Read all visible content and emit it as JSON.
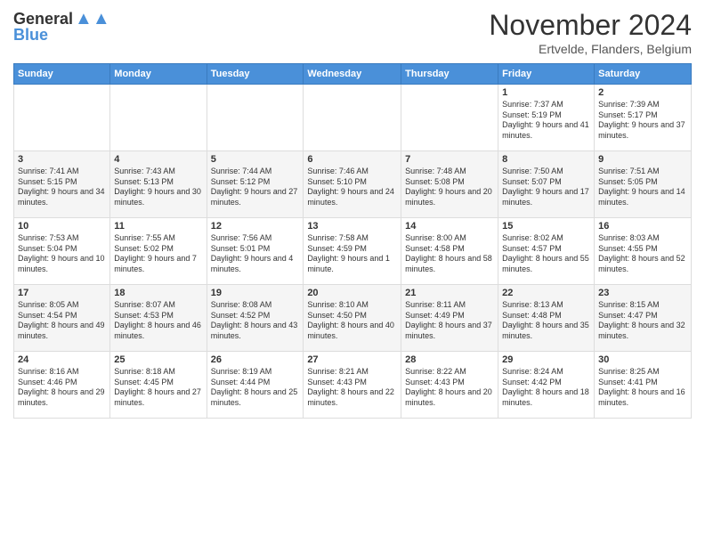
{
  "header": {
    "logo_line1": "General",
    "logo_line2": "Blue",
    "month_title": "November 2024",
    "location": "Ertvelde, Flanders, Belgium"
  },
  "days_of_week": [
    "Sunday",
    "Monday",
    "Tuesday",
    "Wednesday",
    "Thursday",
    "Friday",
    "Saturday"
  ],
  "weeks": [
    [
      {
        "day": "",
        "info": ""
      },
      {
        "day": "",
        "info": ""
      },
      {
        "day": "",
        "info": ""
      },
      {
        "day": "",
        "info": ""
      },
      {
        "day": "",
        "info": ""
      },
      {
        "day": "1",
        "info": "Sunrise: 7:37 AM\nSunset: 5:19 PM\nDaylight: 9 hours and 41 minutes."
      },
      {
        "day": "2",
        "info": "Sunrise: 7:39 AM\nSunset: 5:17 PM\nDaylight: 9 hours and 37 minutes."
      }
    ],
    [
      {
        "day": "3",
        "info": "Sunrise: 7:41 AM\nSunset: 5:15 PM\nDaylight: 9 hours and 34 minutes."
      },
      {
        "day": "4",
        "info": "Sunrise: 7:43 AM\nSunset: 5:13 PM\nDaylight: 9 hours and 30 minutes."
      },
      {
        "day": "5",
        "info": "Sunrise: 7:44 AM\nSunset: 5:12 PM\nDaylight: 9 hours and 27 minutes."
      },
      {
        "day": "6",
        "info": "Sunrise: 7:46 AM\nSunset: 5:10 PM\nDaylight: 9 hours and 24 minutes."
      },
      {
        "day": "7",
        "info": "Sunrise: 7:48 AM\nSunset: 5:08 PM\nDaylight: 9 hours and 20 minutes."
      },
      {
        "day": "8",
        "info": "Sunrise: 7:50 AM\nSunset: 5:07 PM\nDaylight: 9 hours and 17 minutes."
      },
      {
        "day": "9",
        "info": "Sunrise: 7:51 AM\nSunset: 5:05 PM\nDaylight: 9 hours and 14 minutes."
      }
    ],
    [
      {
        "day": "10",
        "info": "Sunrise: 7:53 AM\nSunset: 5:04 PM\nDaylight: 9 hours and 10 minutes."
      },
      {
        "day": "11",
        "info": "Sunrise: 7:55 AM\nSunset: 5:02 PM\nDaylight: 9 hours and 7 minutes."
      },
      {
        "day": "12",
        "info": "Sunrise: 7:56 AM\nSunset: 5:01 PM\nDaylight: 9 hours and 4 minutes."
      },
      {
        "day": "13",
        "info": "Sunrise: 7:58 AM\nSunset: 4:59 PM\nDaylight: 9 hours and 1 minute."
      },
      {
        "day": "14",
        "info": "Sunrise: 8:00 AM\nSunset: 4:58 PM\nDaylight: 8 hours and 58 minutes."
      },
      {
        "day": "15",
        "info": "Sunrise: 8:02 AM\nSunset: 4:57 PM\nDaylight: 8 hours and 55 minutes."
      },
      {
        "day": "16",
        "info": "Sunrise: 8:03 AM\nSunset: 4:55 PM\nDaylight: 8 hours and 52 minutes."
      }
    ],
    [
      {
        "day": "17",
        "info": "Sunrise: 8:05 AM\nSunset: 4:54 PM\nDaylight: 8 hours and 49 minutes."
      },
      {
        "day": "18",
        "info": "Sunrise: 8:07 AM\nSunset: 4:53 PM\nDaylight: 8 hours and 46 minutes."
      },
      {
        "day": "19",
        "info": "Sunrise: 8:08 AM\nSunset: 4:52 PM\nDaylight: 8 hours and 43 minutes."
      },
      {
        "day": "20",
        "info": "Sunrise: 8:10 AM\nSunset: 4:50 PM\nDaylight: 8 hours and 40 minutes."
      },
      {
        "day": "21",
        "info": "Sunrise: 8:11 AM\nSunset: 4:49 PM\nDaylight: 8 hours and 37 minutes."
      },
      {
        "day": "22",
        "info": "Sunrise: 8:13 AM\nSunset: 4:48 PM\nDaylight: 8 hours and 35 minutes."
      },
      {
        "day": "23",
        "info": "Sunrise: 8:15 AM\nSunset: 4:47 PM\nDaylight: 8 hours and 32 minutes."
      }
    ],
    [
      {
        "day": "24",
        "info": "Sunrise: 8:16 AM\nSunset: 4:46 PM\nDaylight: 8 hours and 29 minutes."
      },
      {
        "day": "25",
        "info": "Sunrise: 8:18 AM\nSunset: 4:45 PM\nDaylight: 8 hours and 27 minutes."
      },
      {
        "day": "26",
        "info": "Sunrise: 8:19 AM\nSunset: 4:44 PM\nDaylight: 8 hours and 25 minutes."
      },
      {
        "day": "27",
        "info": "Sunrise: 8:21 AM\nSunset: 4:43 PM\nDaylight: 8 hours and 22 minutes."
      },
      {
        "day": "28",
        "info": "Sunrise: 8:22 AM\nSunset: 4:43 PM\nDaylight: 8 hours and 20 minutes."
      },
      {
        "day": "29",
        "info": "Sunrise: 8:24 AM\nSunset: 4:42 PM\nDaylight: 8 hours and 18 minutes."
      },
      {
        "day": "30",
        "info": "Sunrise: 8:25 AM\nSunset: 4:41 PM\nDaylight: 8 hours and 16 minutes."
      }
    ]
  ]
}
